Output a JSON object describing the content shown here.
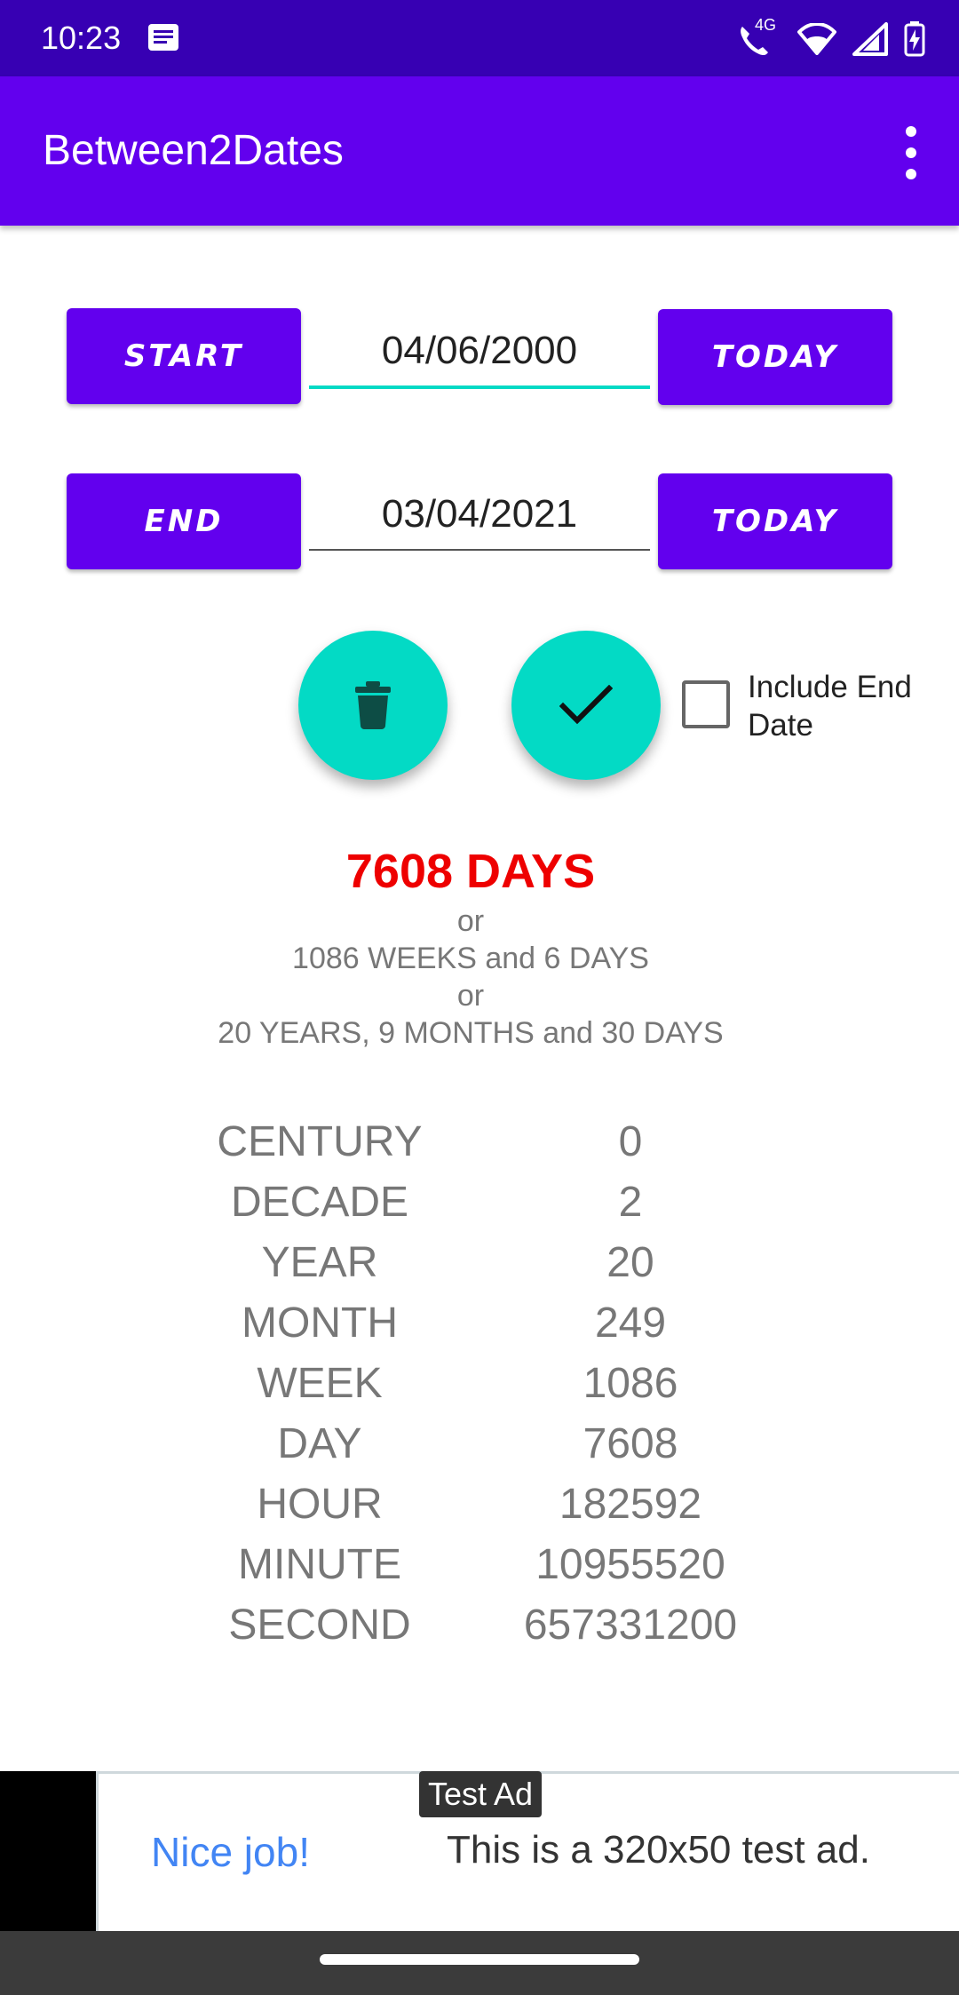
{
  "status_bar": {
    "time": "10:23",
    "network": "4G"
  },
  "app_bar": {
    "title": "Between2Dates"
  },
  "start_row": {
    "button_label": "START",
    "date": "04/06/2000",
    "today_label": "TODAY"
  },
  "end_row": {
    "button_label": "END",
    "date": "03/04/2021",
    "today_label": "TODAY"
  },
  "actions": {
    "include_end_date_label": "Include End Date",
    "include_end_date_checked": false
  },
  "result": {
    "days": "7608 DAYS",
    "or_1": "or",
    "weeks": "1086 WEEKS and 6 DAYS",
    "or_2": "or",
    "ymd": "20 YEARS, 9 MONTHS and 30 DAYS"
  },
  "units": [
    {
      "label": "CENTURY",
      "value": "0"
    },
    {
      "label": "DECADE",
      "value": "2"
    },
    {
      "label": "YEAR",
      "value": "20"
    },
    {
      "label": "MONTH",
      "value": "249"
    },
    {
      "label": "WEEK",
      "value": "1086"
    },
    {
      "label": "DAY",
      "value": "7608"
    },
    {
      "label": "HOUR",
      "value": "182592"
    },
    {
      "label": "MINUTE",
      "value": "10955520"
    },
    {
      "label": "SECOND",
      "value": "657331200"
    }
  ],
  "ad": {
    "tag": "Test Ad",
    "headline": "Nice job!",
    "body": "This is a 320x50 test ad."
  },
  "colors": {
    "primary": "#6200EE",
    "primary_dark": "#3700B3",
    "accent": "#03DAC5",
    "result_red": "#ee0000"
  }
}
